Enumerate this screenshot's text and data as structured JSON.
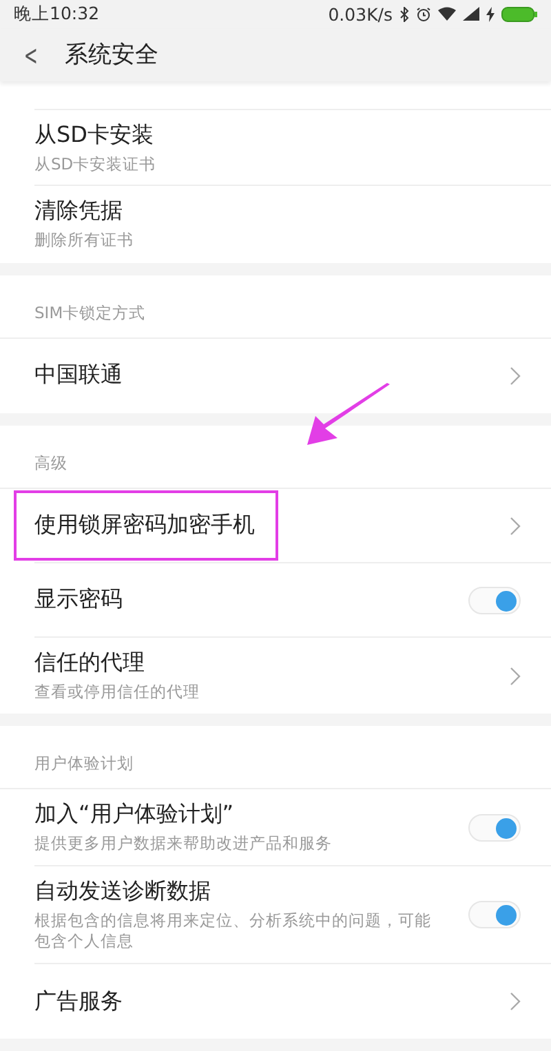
{
  "status_bar": {
    "time": "晚上10:32",
    "speed": "0.03K/s"
  },
  "header": {
    "back": "<",
    "title": "系统安全"
  },
  "groups": [
    {
      "items": [
        {
          "kind": "plain",
          "title": "从SD卡安装",
          "subtitle": "从SD卡安装证书"
        },
        {
          "kind": "plain",
          "title": "清除凭据",
          "subtitle": "删除所有证书"
        }
      ]
    },
    {
      "header": "SIM卡锁定方式",
      "items": [
        {
          "kind": "nav",
          "title": "中国联通"
        }
      ]
    },
    {
      "header": "高级",
      "items": [
        {
          "kind": "nav",
          "title": "使用锁屏密码加密手机",
          "highlighted": true
        },
        {
          "kind": "toggle",
          "title": "显示密码",
          "on": true
        },
        {
          "kind": "nav",
          "title": "信任的代理",
          "subtitle": "查看或停用信任的代理"
        }
      ]
    },
    {
      "header": "用户体验计划",
      "items": [
        {
          "kind": "toggle",
          "title": "加入“用户体验计划”",
          "subtitle": "提供更多用户数据来帮助改进产品和服务",
          "on": true
        },
        {
          "kind": "toggle",
          "title": "自动发送诊断数据",
          "subtitle": "根据包含的信息将用来定位、分析系统中的问题，可能包含个人信息",
          "on": true
        },
        {
          "kind": "nav",
          "title": "广告服务"
        }
      ]
    }
  ]
}
